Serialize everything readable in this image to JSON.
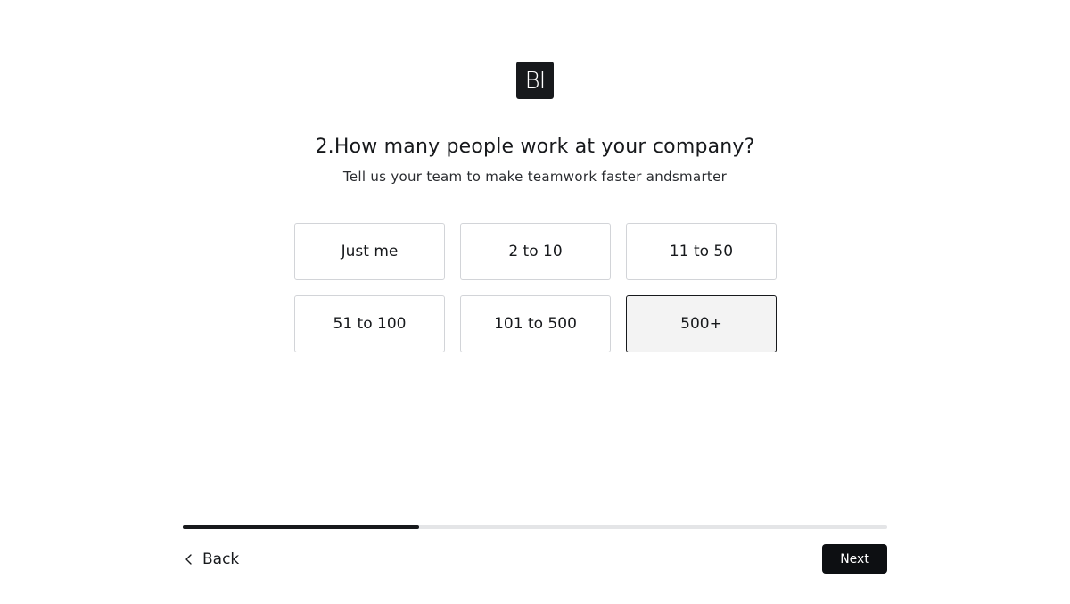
{
  "logo": {
    "text": "BI"
  },
  "question": {
    "title": "2.How many people work at your company?",
    "subtitle": "Tell us your team to make teamwork faster andsmarter"
  },
  "options": [
    {
      "label": "Just me",
      "selected": false
    },
    {
      "label": "2 to 10",
      "selected": false
    },
    {
      "label": "11 to 50",
      "selected": false
    },
    {
      "label": "51 to 100",
      "selected": false
    },
    {
      "label": "101 to 500",
      "selected": false
    },
    {
      "label": "500+",
      "selected": true
    }
  ],
  "progress": {
    "fraction": 0.335
  },
  "nav": {
    "back_label": "Back",
    "back_icon": "chevron-left-icon",
    "next_label": "Next"
  },
  "colors": {
    "primary": "#17191c",
    "selected_bg": "#f3f3f3",
    "border": "#d2d4d8",
    "track": "#e4e5e7"
  }
}
